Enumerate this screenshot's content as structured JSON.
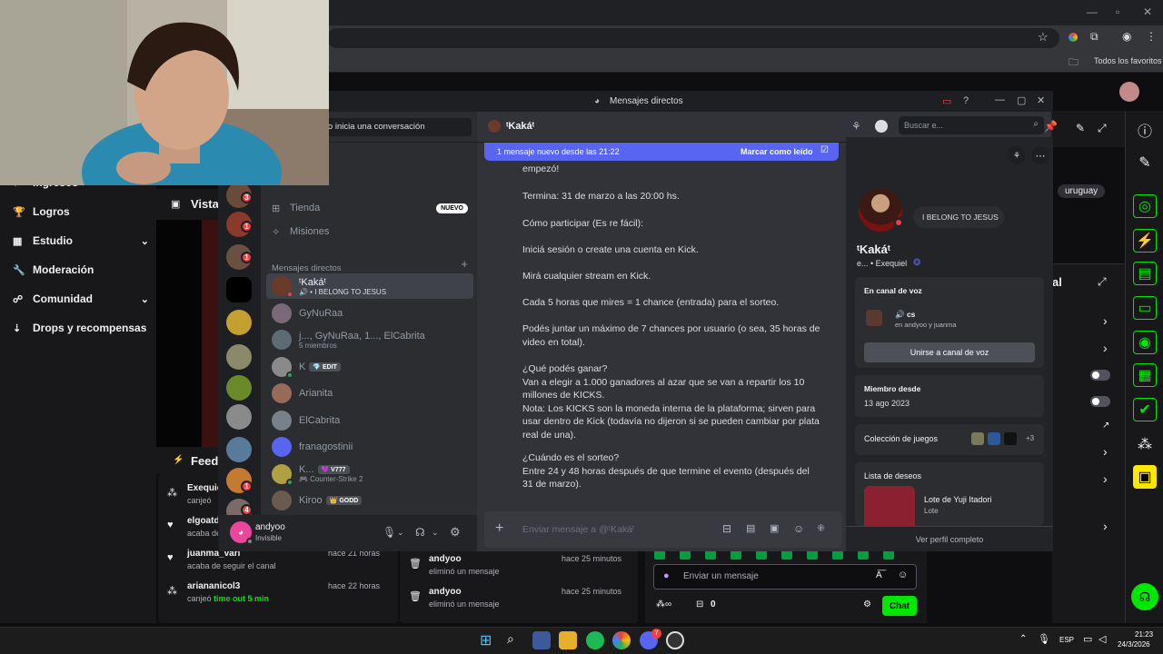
{
  "browser": {
    "bookmarks_label": "Todos los favoritos"
  },
  "twitch_left_nav": [
    {
      "label": "Ingresos",
      "icon": "revenue-icon",
      "has_chevron": false
    },
    {
      "label": "Logros",
      "icon": "trophy-icon",
      "has_chevron": false
    },
    {
      "label": "Estudio",
      "icon": "studio-icon",
      "has_chevron": true
    },
    {
      "label": "Moderación",
      "icon": "wrench-icon",
      "has_chevron": false
    },
    {
      "label": "Comunidad",
      "icon": "community-icon",
      "has_chevron": true
    },
    {
      "label": "Drops y recompensas",
      "icon": "drops-icon",
      "has_chevron": false
    }
  ],
  "twitch_center": {
    "vista_label": "Vista",
    "feed_label": "Feed",
    "tag_label": "uruguay",
    "right_panel_partial": "al"
  },
  "activity_feed": {
    "col1": [
      {
        "name": "Exequie",
        "sub": "canjeó",
        "time": ""
      },
      {
        "name": "elgoatd",
        "sub": "acaba de",
        "time": ""
      },
      {
        "name": "juanma_vari",
        "sub": "acaba de seguir el canal",
        "time": "hace 21 horas"
      },
      {
        "name": "ariananicol3",
        "sub": "canjeó ",
        "sub_highlight": "time out 5 min",
        "time": "hace 22 horas"
      }
    ],
    "col2": [
      {
        "name": "andyoo",
        "sub": "eliminó un mensaje",
        "time": "hace 25 minutos"
      },
      {
        "name": "andyoo",
        "sub": "eliminó un mensaje",
        "time": "hace 25 minutos"
      }
    ]
  },
  "twitch_chat": {
    "input_placeholder": "Enviar un mensaje",
    "points": "0",
    "chat_button": "Chat"
  },
  "discord": {
    "window_title": "Mensajes directos",
    "search_conversation": "a o inicia una conversación",
    "dm_header_name": "ᵗKakáᵗ",
    "search_placeholder": "Buscar e...",
    "new_message_banner": "1 mensaje nuevo desde las 21:22",
    "mark_read": "Marcar como leído",
    "shop_label": "Tienda",
    "shop_badge": "NUEVO",
    "missions_label": "Misiones",
    "dm_section_label": "Mensajes directos",
    "dm_list": [
      {
        "name": "ᵗKakáᵗ",
        "sub": "🔊 • I BELONG TO JESUS",
        "selected": true,
        "status": "dnd",
        "avatar_color": "#6b3a2a"
      },
      {
        "name": "GyNuRaa",
        "sub": "",
        "status": "",
        "avatar_color": "#7a6a78"
      },
      {
        "name": "j..., GyNuRaa, 1..., ElCabrita",
        "sub": "5 miembros",
        "status": "",
        "avatar_color": "#5e6b75"
      },
      {
        "name": "K",
        "sub": "",
        "tag": "💎 EDIT",
        "status": "online",
        "avatar_color": "#8a8a8a"
      },
      {
        "name": "Arianita",
        "sub": "",
        "status": "",
        "avatar_color": "#9a6a58"
      },
      {
        "name": "ElCabrita",
        "sub": "",
        "status": "",
        "avatar_color": "#788089"
      },
      {
        "name": "franagostinii",
        "sub": "",
        "status": "",
        "avatar_color": "#5865f2"
      },
      {
        "name": "K...",
        "sub": "🎮 Counter-Strike 2",
        "tag": "💜 V777",
        "status": "online",
        "avatar_color": "#b0a040"
      },
      {
        "name": "Kiroo",
        "sub": "",
        "tag": "👑 GODD",
        "status": "",
        "avatar_color": "#6a5a50"
      }
    ],
    "server_badges": [
      "3",
      "1",
      "1",
      "1",
      "4"
    ],
    "user": {
      "name": "andyoo",
      "status": "Invisible"
    },
    "messages": [
      "empezó!",
      "Termina: 31 de marzo a las 20:00 hs.",
      "Cómo participar (Es re fácil):",
      "Iniciá sesión o create una cuenta en Kick.",
      "Mirá cualquier stream en Kick.",
      "Cada 5 horas que mires = 1 chance (entrada) para el sorteo.",
      "Podés juntar un máximo de 7 chances por usuario (o sea, 35 horas de video en total).",
      "¿Qué podés ganar?\nVan a elegir a 1.000 ganadores al azar que se van a repartir los 10 millones de KICKS.\nNota: Los KICKS son la moneda interna de la plataforma; sirven para usar dentro de Kick (todavía no dijeron si se pueden cambiar por plata real de una).",
      "¿Cuándo es el sorteo?\nEntre 24 y 48 horas después de que termine el evento (después del 31 de marzo)."
    ],
    "message_input_placeholder": "Enviar mensaje a @ᵗKakáᵗ",
    "profile": {
      "status_bubble": "I BELONG TO JESUS",
      "display_name": "ᵗKakáᵗ",
      "username_line": "e... • Exequiel",
      "voice_label": "En canal de voz",
      "voice_channel": "🔊 cs",
      "voice_sub": "en andyoo y juanma",
      "join_voice_button": "Unirse a canal de voz",
      "member_since_label": "Miembro desde",
      "member_since": "13 ago 2023",
      "games_label": "Colección de juegos",
      "games_more": "+3",
      "wishlist_label": "Lista de deseos",
      "wishlist_item": "Lote de Yuji Itadori",
      "wishlist_sub": "Lote",
      "full_profile": "Ver perfil completo"
    }
  },
  "taskbar": {
    "lang": "ESP",
    "time": "21:23",
    "date": "24/3/2026",
    "discord_badge": "7"
  },
  "colors": {
    "twitch_green": "#00e701",
    "discord_blurple": "#5865f2",
    "discord_red": "#f23f43"
  }
}
